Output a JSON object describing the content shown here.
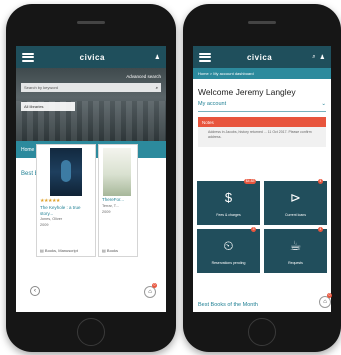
{
  "left": {
    "brand": "civica",
    "advanced_search": "Advanced search",
    "search_placeholder": "Search by keyword",
    "location": "All libraries",
    "breadcrumb": "Home",
    "section_title": "Best Books of the Month",
    "books": [
      {
        "stars": "★★★★★",
        "title": "The Keyhole : a true story...",
        "author": "Jones, Oliver",
        "year": "2009",
        "format": "Books, Manuscript"
      },
      {
        "title": "ThereFor...",
        "author": "Terrar, T...",
        "year": "2009",
        "format": "Books"
      }
    ],
    "prev_icon": "‹",
    "basket_icon": "basket-icon",
    "basket_count": "0"
  },
  "right": {
    "brand": "civica",
    "breadcrumb": "Home > My account dashboard",
    "welcome": "Welcome Jeremy Langley",
    "my_account": "My account",
    "chevron": "⌄",
    "notice_title": "Notes",
    "notice_text": "Address in Jacobs, history returned ... 11 Oct 2017. Please confirm address.",
    "tiles": [
      {
        "icon": "$",
        "label": "Fees & charges",
        "badge": "$4.83"
      },
      {
        "icon": "⊳",
        "label": "Current loans",
        "badge": "4"
      },
      {
        "icon": "⏲",
        "label": "Reservations pending",
        "badge": "3"
      },
      {
        "icon": "☕",
        "label": "Requests",
        "badge": "4"
      }
    ],
    "section_title": "Best Books of the Month",
    "basket_count": "0"
  },
  "colors": {
    "header": "#1f4f5c",
    "accent": "#2c8a9d",
    "alert": "#e8553d"
  }
}
